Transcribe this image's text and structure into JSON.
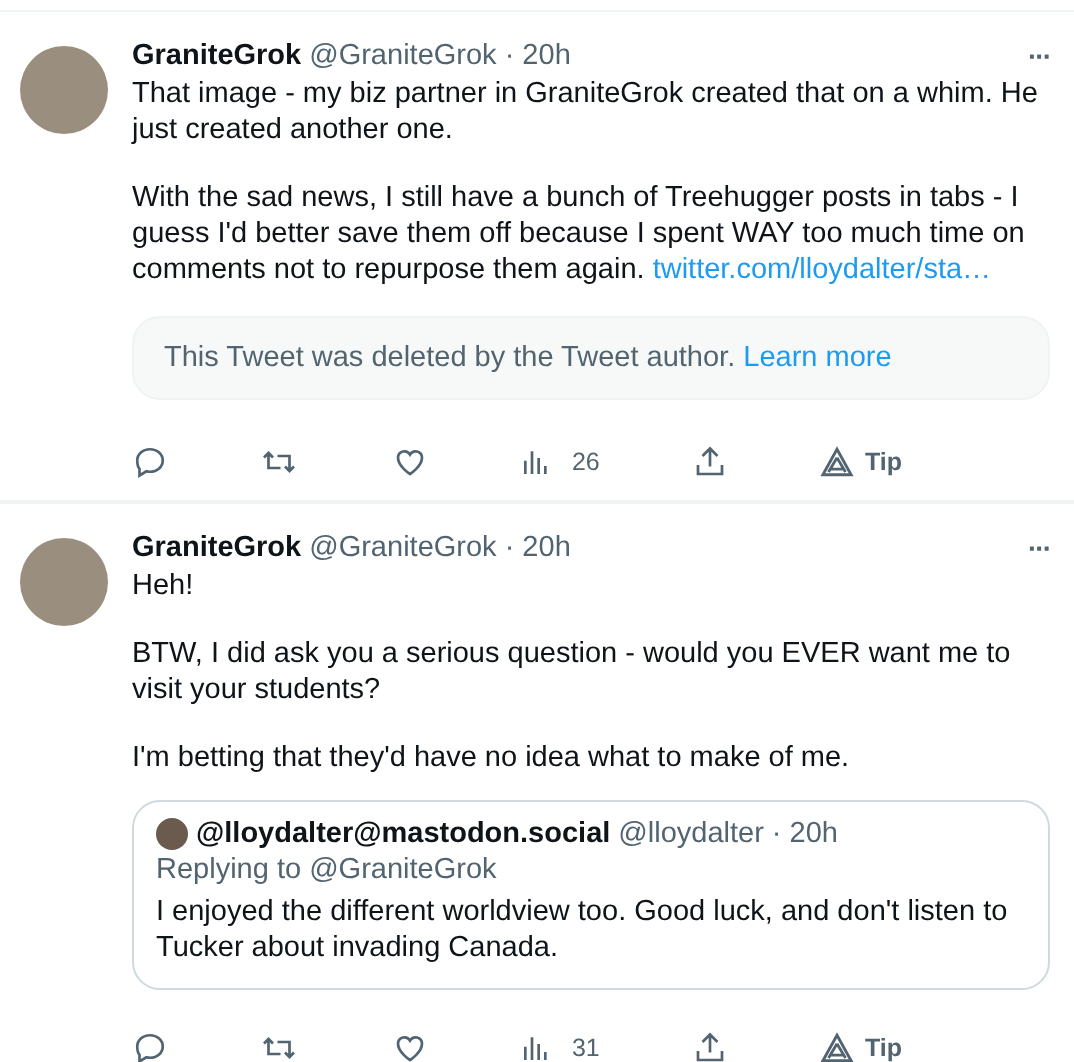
{
  "tweets": [
    {
      "author": "GraniteGrok",
      "meta": "@GraniteGrok · 20h",
      "menu": "···",
      "paragraphs": [
        {
          "text": "That image - my biz partner in GraniteGrok created that on a whim.  He just created another one."
        },
        {
          "text": "With the sad news, I still have a bunch of Treehugger posts in tabs - I guess I'd better save them off because I spent WAY too much time on comments not to repurpose them again.",
          "link": "twitter.com/lloydalter/sta…"
        }
      ],
      "deleted_notice": {
        "text": "This Tweet was deleted by the Tweet author.",
        "link": "Learn more"
      },
      "views": "26",
      "tip": "Tip"
    },
    {
      "author": "GraniteGrok",
      "meta": "@GraniteGrok · 20h",
      "menu": "···",
      "paragraphs": [
        {
          "text": "Heh!"
        },
        {
          "text": "BTW, I did ask you a serious question - would you EVER want me to visit your students?"
        },
        {
          "text": "I'm betting that they'd have no idea what to make of me."
        }
      ],
      "quote": {
        "author": "@lloydalter@mastodon.social",
        "meta": "@lloydalter · 20h",
        "replying": "Replying to @GraniteGrok",
        "text": "I enjoyed the different worldview too. Good luck, and don't listen to Tucker about invading Canada."
      },
      "views": "31",
      "tip": "Tip"
    }
  ]
}
